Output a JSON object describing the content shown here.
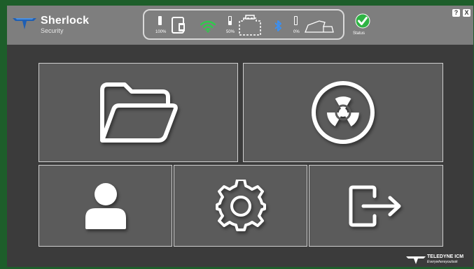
{
  "brand": {
    "name": "Sherlock",
    "subtitle": "Security",
    "color": "#ffffff"
  },
  "device_status": {
    "tablet_battery": {
      "percent_label": "100%",
      "level": 1.0
    },
    "wifi": {
      "connected": true,
      "color": "#2ecc4a"
    },
    "scanner_battery": {
      "percent_label": "50%",
      "level": 0.5
    },
    "bluetooth": {
      "connected": true,
      "color": "#3b8ff0"
    },
    "sensor_battery": {
      "percent_label": "0%",
      "level": 0.0
    },
    "icons": [
      "tablet-icon",
      "wifi-icon",
      "scanner-icon",
      "bluetooth-icon",
      "sensor-device-icon"
    ]
  },
  "status": {
    "label": "Status",
    "state": "ok",
    "color": "#2fb344"
  },
  "window_controls": {
    "help_label": "?",
    "close_label": "X"
  },
  "tiles": [
    {
      "id": "files",
      "icon": "folder-icon"
    },
    {
      "id": "scan",
      "icon": "radiation-icon"
    },
    {
      "id": "user",
      "icon": "user-icon"
    },
    {
      "id": "settings",
      "icon": "gear-icon"
    },
    {
      "id": "logout",
      "icon": "logout-icon"
    }
  ],
  "footer": {
    "company": "TELEDYNE ICM",
    "tagline": "Everywhereyoulook"
  },
  "colors": {
    "frame": "#1d5e2a",
    "app_bg": "#3b3b3b",
    "topbar": "#7e7e7e",
    "tile_bg": "#5b5b5b",
    "tile_border": "#cfcfcf"
  }
}
